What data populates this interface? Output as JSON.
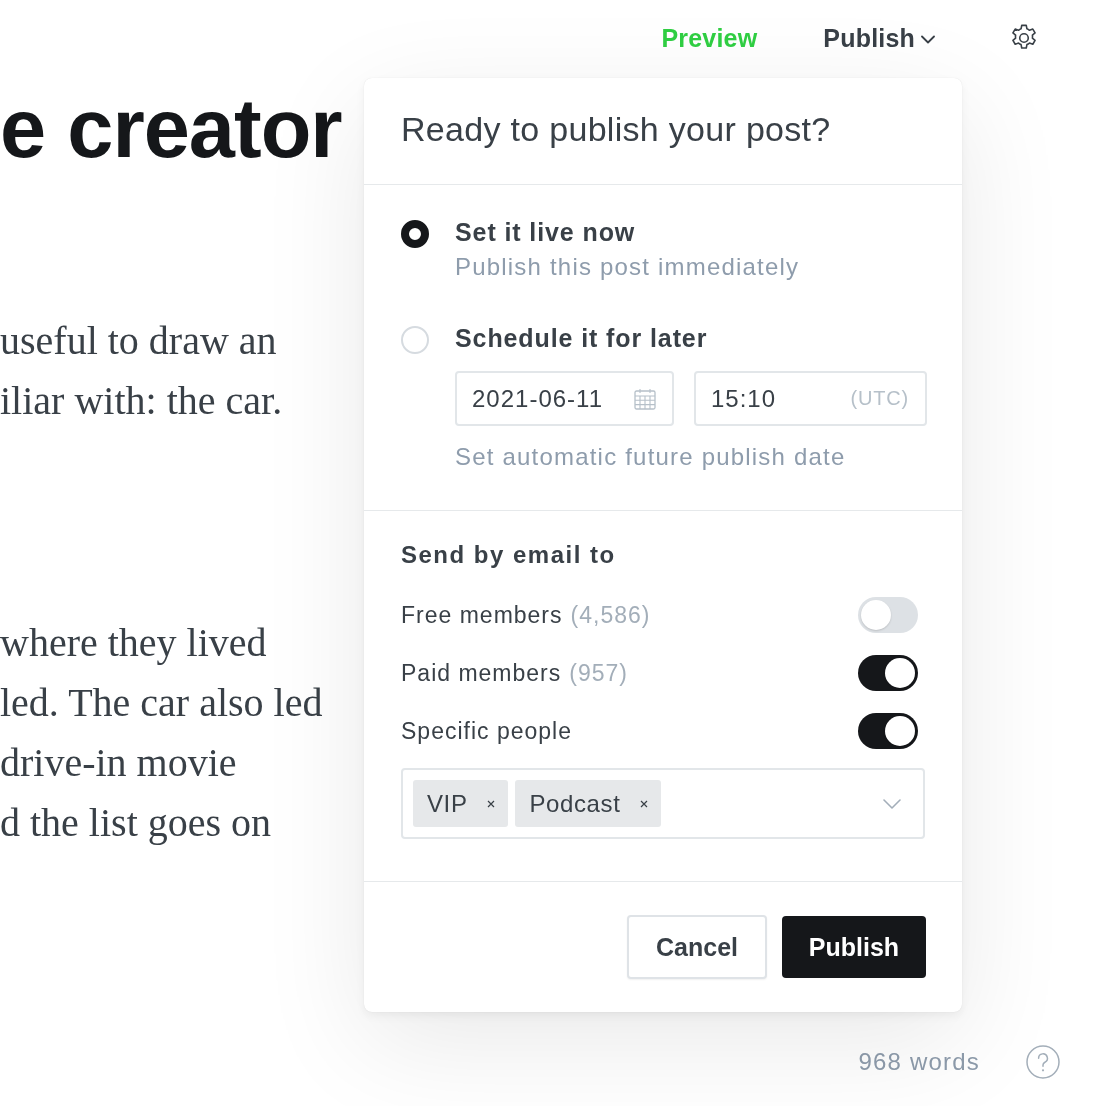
{
  "top_bar": {
    "preview": "Preview",
    "publish_menu": "Publish"
  },
  "editor": {
    "title": "e creator",
    "paragraphs": [
      {
        "lines": [
          "useful to draw an",
          "iliar with: the car."
        ]
      },
      {
        "lines": [
          "where they lived",
          "led. The car also led",
          "drive-in movie",
          "d the list goes on"
        ]
      }
    ]
  },
  "publish_panel": {
    "title": "Ready to publish your post?",
    "options": [
      {
        "kind": "now",
        "label": "Set it live now",
        "description": "Publish this post immediately",
        "selected": true
      },
      {
        "kind": "schedule",
        "label": "Schedule it for later",
        "selected": false,
        "date": "2021-06-11",
        "time": "15:10",
        "timezone": "(UTC)",
        "hint": "Set automatic future publish date"
      }
    ],
    "email": {
      "heading": "Send by email to",
      "recipients": [
        {
          "label": "Free members",
          "count": "(4,586)",
          "on": false
        },
        {
          "label": "Paid members",
          "count": "(957)",
          "on": true
        },
        {
          "label": "Specific people",
          "on": true
        }
      ],
      "tags": [
        "VIP",
        "Podcast"
      ]
    },
    "buttons": [
      {
        "label": "Cancel",
        "kind": "secondary"
      },
      {
        "label": "Publish",
        "kind": "primary"
      }
    ]
  },
  "status_bar": {
    "word_count": "968 words"
  }
}
